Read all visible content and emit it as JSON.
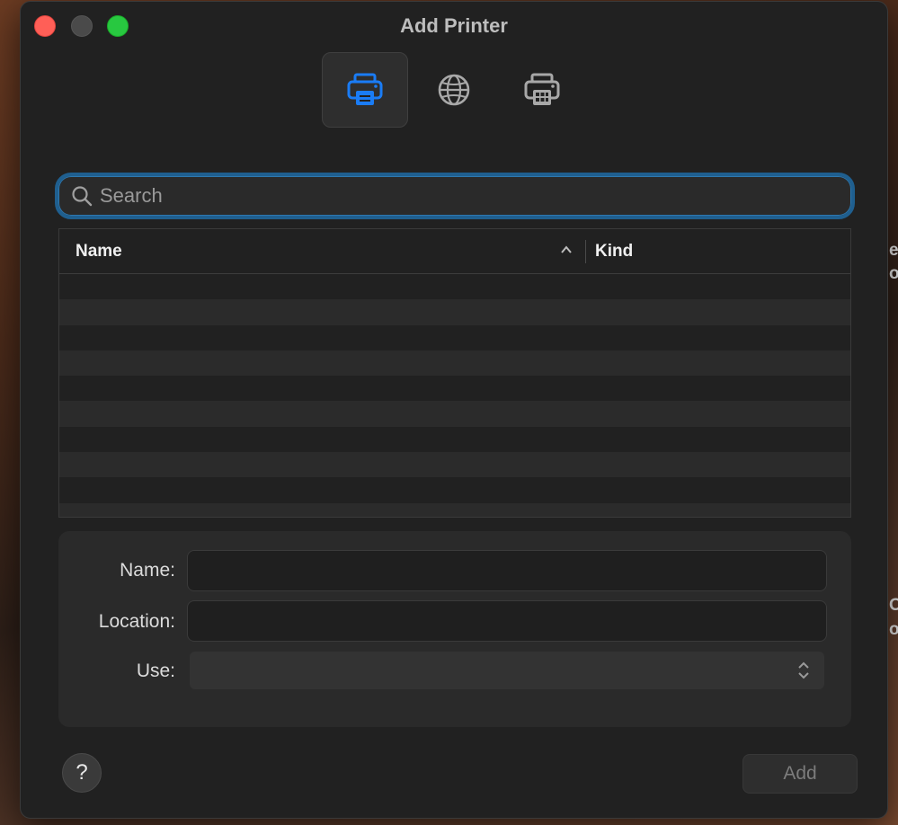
{
  "window": {
    "title": "Add Printer"
  },
  "toolbar": {
    "buttons": [
      {
        "icon": "local-printer-icon",
        "active": true
      },
      {
        "icon": "ip-globe-icon",
        "active": false
      },
      {
        "icon": "windows-printer-icon",
        "active": false
      }
    ]
  },
  "search": {
    "placeholder": "Search",
    "value": ""
  },
  "printer_list": {
    "columns": [
      "Name",
      "Kind"
    ],
    "sort_column": "Name",
    "sort_direction": "ascending",
    "rows": []
  },
  "details": {
    "name_label": "Name:",
    "name_value": "",
    "location_label": "Location:",
    "location_value": "",
    "use_label": "Use:",
    "use_value": ""
  },
  "footer": {
    "help_label": "?",
    "add_label": "Add",
    "add_enabled": false
  },
  "colors": {
    "accent": "#1a7cf5",
    "focus_ring": "#2d78b0",
    "window_bg": "#212121",
    "close": "#ff5f57",
    "maximize": "#28c840"
  },
  "background": {
    "peek_text": [
      "e",
      "ou",
      "Or",
      "ol"
    ]
  }
}
